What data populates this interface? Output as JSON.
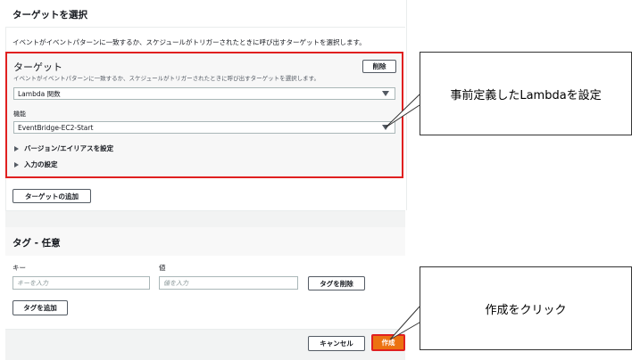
{
  "panel1": {
    "title": "ターゲットを選択",
    "description": "イベントがイベントパターンに一致するか、スケジュールがトリガーされたときに呼び出すターゲットを選択します。"
  },
  "target": {
    "heading": "ターゲット",
    "description": "イベントがイベントパターンに一致するか、スケジュールがトリガーされたときに呼び出すターゲットを選択します。",
    "remove_label": "削除",
    "type_value": "Lambda 関数",
    "function_label": "機能",
    "function_value": "EventBridge-EC2-Start",
    "version_alias_label": "バージョン/エイリアスを設定",
    "input_config_label": "入力の設定"
  },
  "add_target_label": "ターゲットの追加",
  "tags": {
    "title": "タグ - 任意",
    "key_label": "キー",
    "value_label": "値",
    "key_placeholder": "キーを入力",
    "value_placeholder": "値を入力",
    "remove_tag_label": "タグを削除",
    "add_tag_label": "タグを追加"
  },
  "footer": {
    "cancel_label": "キャンセル",
    "create_label": "作成"
  },
  "callouts": {
    "lambda_note": "事前定義したLambdaを設定",
    "create_note": "作成をクリック"
  },
  "colors": {
    "highlight": "#e02020",
    "primary_button": "#ec7211",
    "border": "#545b64"
  }
}
